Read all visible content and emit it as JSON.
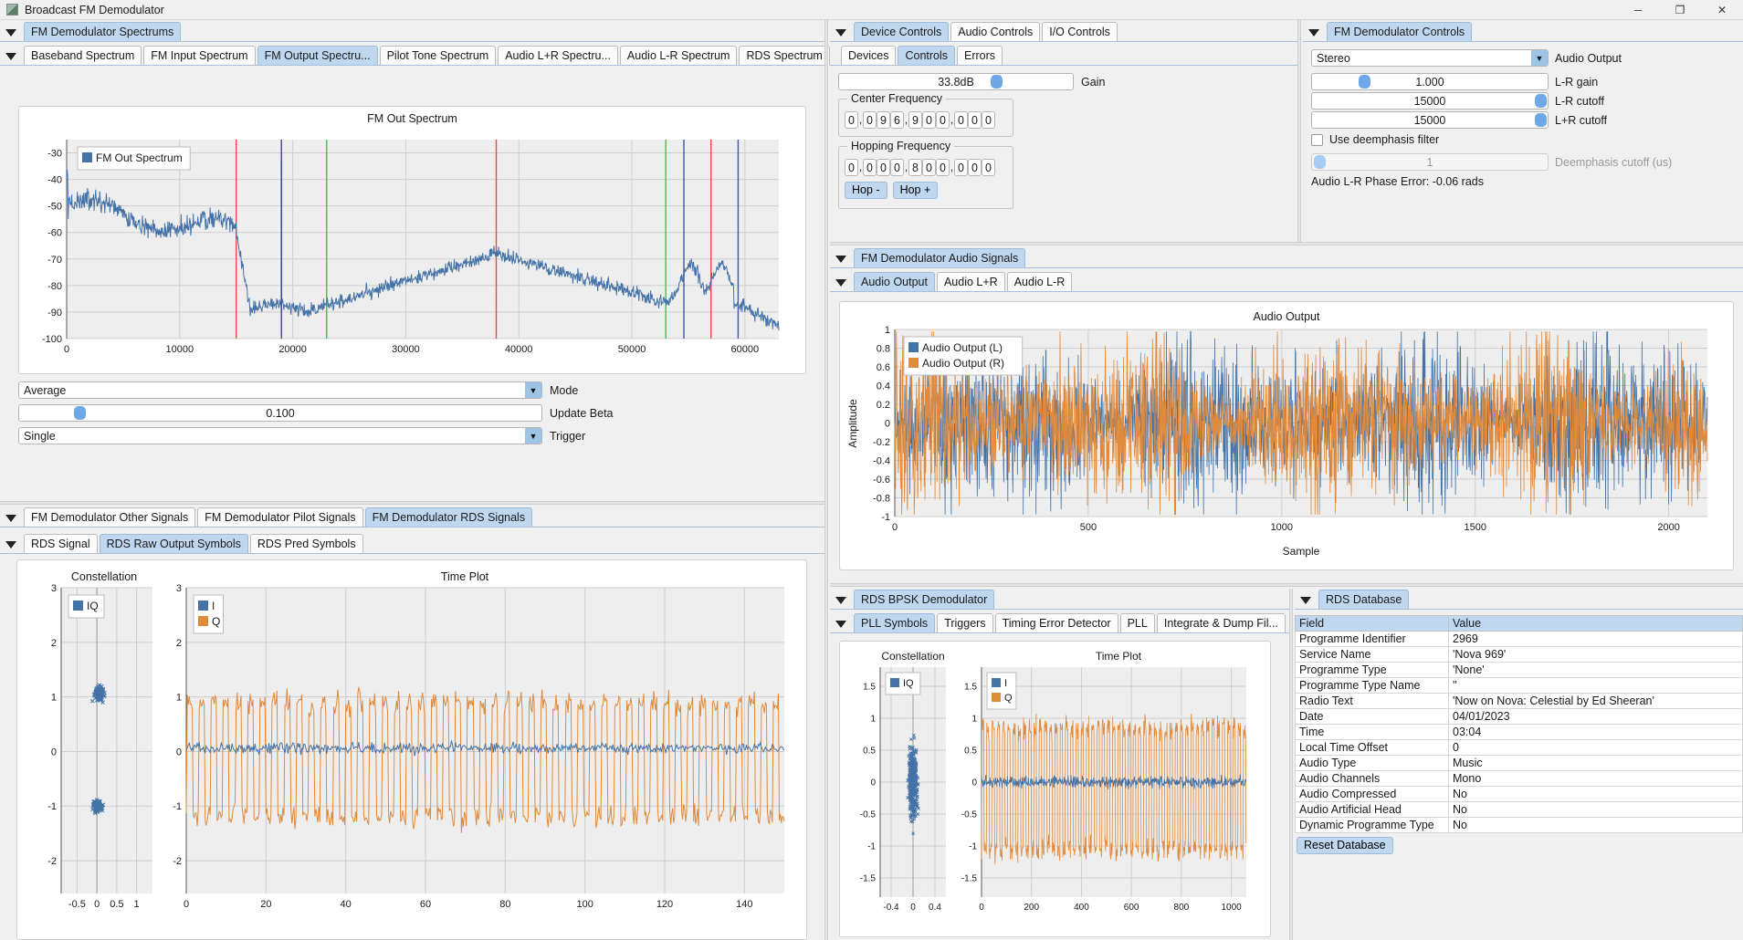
{
  "window": {
    "title": "Broadcast FM Demodulator",
    "minimize": "─",
    "maximize": "❐",
    "close": "✕"
  },
  "spectrums_panel": {
    "group_tab": "FM Demodulator Spectrums",
    "tabs": [
      {
        "label": "Baseband Spectrum",
        "selected": false
      },
      {
        "label": "FM Input Spectrum",
        "selected": false
      },
      {
        "label": "FM Output Spectru...",
        "selected": true
      },
      {
        "label": "Pilot Tone Spectrum",
        "selected": false
      },
      {
        "label": "Audio L+R Spectru...",
        "selected": false
      },
      {
        "label": "Audio L-R Spectrum",
        "selected": false
      },
      {
        "label": "RDS Spectrum",
        "selected": false
      }
    ],
    "mode": {
      "value": "Average",
      "label": "Mode"
    },
    "update_beta": {
      "value": "0.100",
      "label": "Update Beta",
      "fraction": 0.1
    },
    "trigger": {
      "value": "Single",
      "label": "Trigger"
    }
  },
  "device_controls": {
    "group_tabs": [
      {
        "label": "Device Controls",
        "selected": true
      },
      {
        "label": "Audio Controls",
        "selected": false
      },
      {
        "label": "I/O Controls",
        "selected": false
      }
    ],
    "sub_tabs": [
      {
        "label": "Devices",
        "selected": false
      },
      {
        "label": "Controls",
        "selected": true
      },
      {
        "label": "Errors",
        "selected": false
      }
    ],
    "gain": {
      "value": "33.8dB",
      "label": "Gain",
      "fraction": 0.67
    },
    "center_frequency": {
      "title": "Center Frequency",
      "digits": [
        "0",
        "0",
        "9",
        "6",
        "9",
        "0",
        "0",
        "0",
        "0",
        "0"
      ]
    },
    "hopping_frequency": {
      "title": "Hopping Frequency",
      "digits": [
        "0",
        "0",
        "0",
        "0",
        "8",
        "0",
        "0",
        "0",
        "0",
        "0"
      ]
    },
    "hop_minus": "Hop -",
    "hop_plus": "Hop +"
  },
  "demod_controls": {
    "group_tab": "FM Demodulator Controls",
    "audio_output": {
      "value": "Stereo",
      "label": "Audio Output"
    },
    "lr_gain": {
      "value": "1.000",
      "label": "L-R gain",
      "fraction": 0.2
    },
    "lr_cutoff": {
      "value": "15000",
      "label": "L-R cutoff",
      "fraction": 0.965
    },
    "lplusr_cutoff": {
      "value": "15000",
      "label": "L+R cutoff",
      "fraction": 0.965
    },
    "deemphasis_checkbox": {
      "label": "Use deemphasis filter",
      "checked": false
    },
    "deemphasis_cutoff": {
      "value": "1",
      "label": "Deemphasis cutoff (us)",
      "fraction": 0.01,
      "disabled": true
    },
    "phase_error": "Audio L-R Phase Error: -0.06 rads"
  },
  "audio_signals": {
    "group_tab": "FM Demodulator Audio Signals",
    "tabs": [
      {
        "label": "Audio Output",
        "selected": true
      },
      {
        "label": "Audio L+R",
        "selected": false
      },
      {
        "label": "Audio L-R",
        "selected": false
      }
    ]
  },
  "other_signals": {
    "group_tabs": [
      {
        "label": "FM Demodulator Other Signals",
        "selected": false
      },
      {
        "label": "FM Demodulator Pilot Signals",
        "selected": false
      },
      {
        "label": "FM Demodulator RDS Signals",
        "selected": true
      }
    ],
    "sub_tabs": [
      {
        "label": "RDS Signal",
        "selected": false
      },
      {
        "label": "RDS Raw Output Symbols",
        "selected": true
      },
      {
        "label": "RDS Pred Symbols",
        "selected": false
      }
    ]
  },
  "bpsk_demod": {
    "group_tab": "RDS BPSK Demodulator",
    "sub_tabs": [
      {
        "label": "PLL Symbols",
        "selected": true
      },
      {
        "label": "Triggers",
        "selected": false
      },
      {
        "label": "Timing Error Detector",
        "selected": false
      },
      {
        "label": "PLL",
        "selected": false
      },
      {
        "label": "Integrate & Dump Fil...",
        "selected": false
      }
    ]
  },
  "rds_database": {
    "group_tab": "RDS Database",
    "columns": [
      "Field",
      "Value"
    ],
    "rows": [
      [
        "Programme Identifier",
        "2969"
      ],
      [
        "Service Name",
        "'Nova 969'"
      ],
      [
        "Programme Type",
        "'None'"
      ],
      [
        "Programme Type Name",
        "''"
      ],
      [
        "Radio Text",
        "'Now on Nova: Celestial by Ed Sheeran'"
      ],
      [
        "Date",
        "04/01/2023"
      ],
      [
        "Time",
        "03:04"
      ],
      [
        "Local Time Offset",
        "0"
      ],
      [
        "Audio Type",
        "Music"
      ],
      [
        "Audio Channels",
        "Mono"
      ],
      [
        "Audio Compressed",
        "No"
      ],
      [
        "Audio Artificial Head",
        "No"
      ],
      [
        "Dynamic Programme Type",
        "No"
      ]
    ],
    "reset_button": "Reset Database"
  },
  "chart_data": [
    {
      "id": "fm_out_spectrum",
      "type": "line",
      "title": "FM Out Spectrum",
      "legend": [
        {
          "name": "FM Out Spectrum",
          "color": "#4573a7"
        }
      ],
      "legend_position": "top-left",
      "xlabel": "",
      "ylabel": "",
      "xlim": [
        0,
        63000
      ],
      "ylim": [
        -100,
        -25
      ],
      "xticks": [
        0,
        10000,
        20000,
        30000,
        40000,
        50000,
        60000
      ],
      "yticks": [
        -100,
        -90,
        -80,
        -70,
        -60,
        -50,
        -40,
        -30
      ],
      "grid": true,
      "markers": [
        {
          "x": 15000,
          "color": "#e8413c"
        },
        {
          "x": 19000,
          "color": "#e8413c"
        },
        {
          "x": 19000,
          "color": "#3d4fa0"
        },
        {
          "x": 23000,
          "color": "#2fc24d"
        },
        {
          "x": 38000,
          "color": "#e8413c"
        },
        {
          "x": 53000,
          "color": "#2fc24d"
        },
        {
          "x": 54600,
          "color": "#3d4fa0"
        },
        {
          "x": 57000,
          "color": "#e8413c"
        },
        {
          "x": 59400,
          "color": "#3d4fa0"
        }
      ],
      "trace_color": "#4573a7",
      "description": "Noisy FM multiplex spectrum: high at DC (-38 dB) falling to -60 dB by 14 kHz, steep drop to -88 dB noise floor from 15-22 kHz, rising to a -68 dB broad L-R sideband hump peaking near 38 kHz, decaying to -85 dB by 52 kHz, twin RDS peaks near 55-58 kHz at -73 dB, then falling to -95 dB."
    },
    {
      "id": "audio_output",
      "type": "line",
      "title": "Audio Output",
      "legend": [
        {
          "name": "Audio Output (L)",
          "color": "#4573a7"
        },
        {
          "name": "Audio Output (R)",
          "color": "#e08a3c"
        }
      ],
      "legend_position": "top-left",
      "xlabel": "Sample",
      "ylabel": "Amplitude",
      "xlim": [
        0,
        2100
      ],
      "ylim": [
        -1,
        1
      ],
      "xticks": [
        0,
        500,
        1000,
        1500,
        2000
      ],
      "yticks": [
        -1,
        -0.8,
        -0.6,
        -0.4,
        -0.2,
        0,
        0.2,
        0.4,
        0.6,
        0.8,
        1
      ],
      "grid": true,
      "description": "Two dense noisy audio waveforms (left blue, right orange) filling +/-0.8 amplitude over 2100 samples with slow envelope modulation."
    },
    {
      "id": "rds_raw_constellation",
      "type": "scatter",
      "title": "Constellation",
      "legend": [
        {
          "name": "IQ",
          "color": "#4573a7"
        }
      ],
      "legend_position": "top-left",
      "xlim": [
        -0.9,
        1.4
      ],
      "ylim": [
        -2.6,
        3
      ],
      "xticks": [
        -0.5,
        0,
        0.5,
        1
      ],
      "yticks": [
        -2,
        -1,
        0,
        1,
        2,
        3
      ],
      "grid": true,
      "clusters": [
        {
          "center": [
            0.05,
            1.05
          ],
          "spread": 0.25,
          "count": 120
        },
        {
          "center": [
            0.02,
            -1.0
          ],
          "spread": 0.22,
          "count": 110
        }
      ],
      "description": "BPSK constellation with two clusters near +1 and -1 on the quadrature axis."
    },
    {
      "id": "rds_raw_timeplot",
      "type": "line",
      "title": "Time Plot",
      "legend": [
        {
          "name": "I",
          "color": "#4573a7"
        },
        {
          "name": "Q",
          "color": "#e08a3c"
        }
      ],
      "legend_position": "top-left",
      "xlabel": "",
      "ylabel": "",
      "xlim": [
        0,
        150
      ],
      "ylim": [
        -2.6,
        3
      ],
      "xticks": [
        0,
        20,
        40,
        60,
        80,
        100,
        120,
        140
      ],
      "yticks": [
        -2,
        -1,
        0,
        1,
        2,
        3
      ],
      "grid": true,
      "description": "Orange Q trace oscillating rapidly between +1.3 and -1.6; blue I trace small ripple around 0."
    },
    {
      "id": "pll_constellation",
      "type": "scatter",
      "title": "Constellation",
      "legend": [
        {
          "name": "IQ",
          "color": "#4573a7"
        }
      ],
      "legend_position": "top-left",
      "xlim": [
        -0.6,
        0.6
      ],
      "ylim": [
        -1.8,
        1.8
      ],
      "xticks": [
        -0.4,
        0,
        0.4
      ],
      "yticks": [
        -1.5,
        -1,
        -0.5,
        0,
        0.5,
        1,
        1.5
      ],
      "grid": true,
      "clusters": [
        {
          "center": [
            0.0,
            0.0
          ],
          "spread": 0.9,
          "count": 420
        }
      ],
      "description": "Dense vertical streak of IQ samples centred on zero spanning -1.3 to +1.3."
    },
    {
      "id": "pll_timeplot",
      "type": "line",
      "title": "Time Plot",
      "legend": [
        {
          "name": "I",
          "color": "#4573a7"
        },
        {
          "name": "Q",
          "color": "#e08a3c"
        }
      ],
      "legend_position": "top-left",
      "xlabel": "",
      "ylabel": "",
      "xlim": [
        0,
        1060
      ],
      "ylim": [
        -1.8,
        1.8
      ],
      "xticks": [
        0,
        200,
        400,
        600,
        800,
        1000
      ],
      "yticks": [
        -1.5,
        -1,
        -0.5,
        0,
        0.5,
        1,
        1.5
      ],
      "grid": true,
      "description": "Orange Q trace oscillating densely between +1 and -1.2 across 1000 samples; blue I trace low-amplitude ripple near 0."
    }
  ]
}
